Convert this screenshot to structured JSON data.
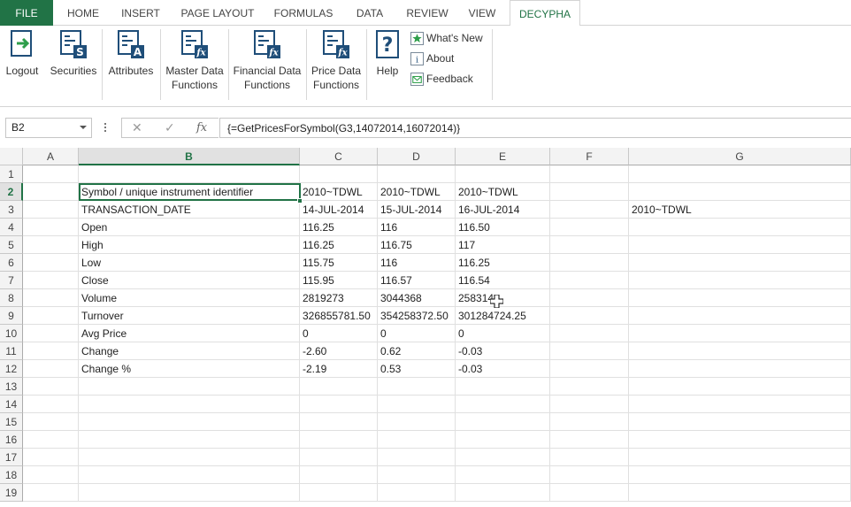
{
  "ribbon_tabs": [
    {
      "label": "FILE"
    },
    {
      "label": "HOME"
    },
    {
      "label": "INSERT"
    },
    {
      "label": "PAGE LAYOUT"
    },
    {
      "label": "FORMULAS"
    },
    {
      "label": "DATA"
    },
    {
      "label": "REVIEW"
    },
    {
      "label": "VIEW"
    },
    {
      "label": "DECYPHA"
    }
  ],
  "ribbon": {
    "logout": {
      "label1": "Logout",
      "icon": "logout-icon"
    },
    "securities": {
      "label1": "Securities",
      "icon": "securities-icon"
    },
    "attributes": {
      "label1": "Attributes",
      "icon": "attributes-icon"
    },
    "master_data": {
      "label1": "Master Data",
      "label2": "Functions",
      "icon": "fx-function-icon"
    },
    "financial_data": {
      "label1": "Financial Data",
      "label2": "Functions",
      "icon": "fx-function-icon"
    },
    "price_data": {
      "label1": "Price Data",
      "label2": "Functions",
      "icon": "fx-function-icon"
    },
    "help": {
      "label1": "Help",
      "icon": "help-icon"
    },
    "whats_new": {
      "label": "What's New",
      "icon": "star-icon"
    },
    "about": {
      "label": "About",
      "icon": "info-icon"
    },
    "feedback": {
      "label": "Feedback",
      "icon": "envelope-icon"
    }
  },
  "formula_bar": {
    "name_box": "B2",
    "formula": "{=GetPricesForSymbol(G3,14072014,16072014)}",
    "cancel_symbol": "✕",
    "enter_symbol": "✓",
    "fx_symbol": "fx"
  },
  "columns": [
    "A",
    "B",
    "C",
    "D",
    "E",
    "F",
    "G"
  ],
  "rows": [
    "1",
    "2",
    "3",
    "4",
    "5",
    "6",
    "7",
    "8",
    "9",
    "10",
    "11",
    "12",
    "13",
    "14",
    "15",
    "16",
    "17",
    "18",
    "19"
  ],
  "cells": {
    "B2": "Symbol / unique instrument identifier",
    "C2": "2010~TDWL",
    "D2": "2010~TDWL",
    "E2": "2010~TDWL",
    "B3": "TRANSACTION_DATE",
    "C3": "14-JUL-2014",
    "D3": "15-JUL-2014",
    "E3": "16-JUL-2014",
    "G3": "2010~TDWL",
    "B4": "Open",
    "C4": "116.25",
    "D4": "116",
    "E4": "116.50",
    "B5": "High",
    "C5": "116.25",
    "D5": "116.75",
    "E5": "117",
    "B6": "Low",
    "C6": "115.75",
    "D6": "116",
    "E6": "116.25",
    "B7": "Close",
    "C7": "115.95",
    "D7": "116.57",
    "E7": "116.54",
    "B8": "Volume",
    "C8": "2819273",
    "D8": "3044368",
    "E8": "258314",
    "B9": "Turnover",
    "C9": "326855781.50",
    "D9": "354258372.50",
    "E9": "301284724.25",
    "B10": "Avg Price",
    "C10": "0",
    "D10": "0",
    "E10": "0",
    "B11": "Change",
    "C11": "-2.60",
    "D11": "0.62",
    "E11": "-0.03",
    "B12": "Change %",
    "C12": "-2.19",
    "D12": "0.53",
    "E12": "-0.03"
  },
  "colors": {
    "excel_green": "#217346",
    "icon_blue": "#1f4e79"
  }
}
